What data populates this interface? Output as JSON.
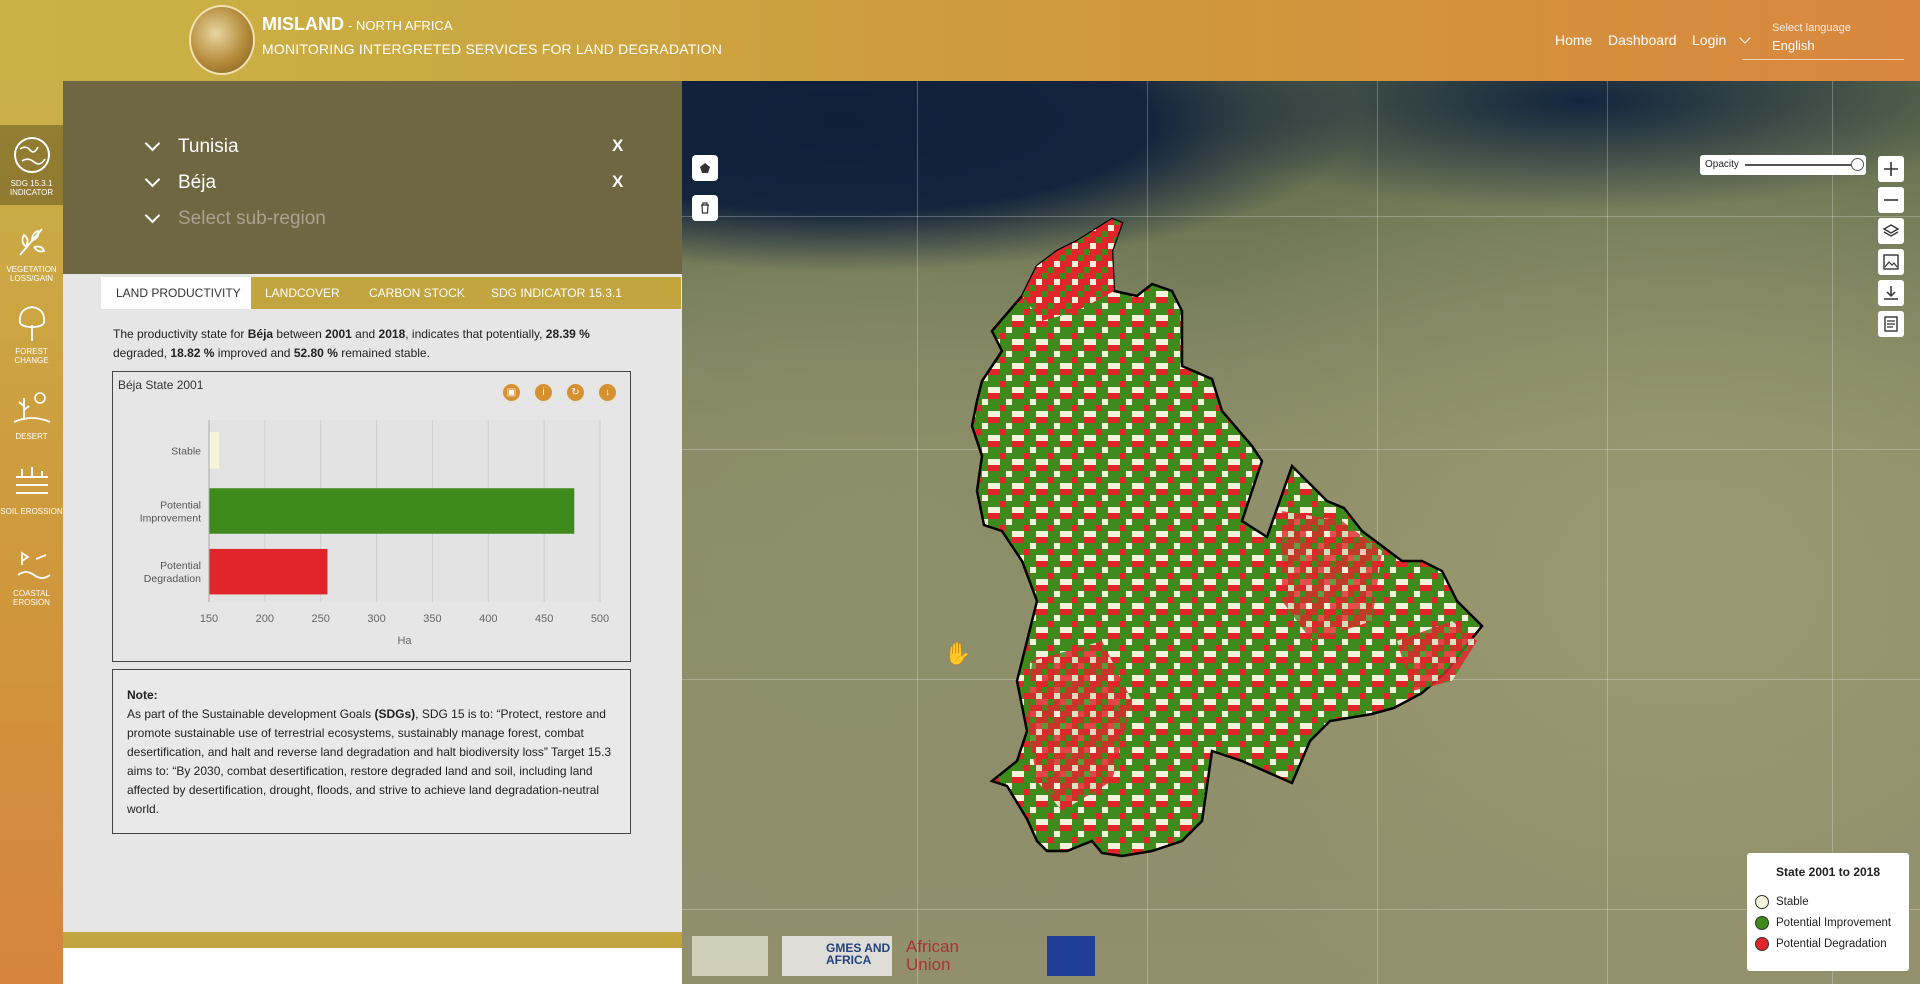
{
  "header": {
    "app_name": "MISLAND",
    "region": "- NORTH AFRICA",
    "subtitle": "MONITORING INTERGRETED SERVICES FOR LAND DEGRADATION",
    "nav": [
      "Home",
      "Dashboard",
      "Login"
    ],
    "language_label": "Select language",
    "language_value": "English"
  },
  "sidebar": {
    "items": [
      {
        "label": "SDG 15.3.1 INDICATOR",
        "icon": "globe-icon"
      },
      {
        "label": "VEGETATION LOSS/GAIN",
        "icon": "leaves-icon"
      },
      {
        "label": "FOREST CHANGE",
        "icon": "tree-icon"
      },
      {
        "label": "DESERT",
        "icon": "desert-icon"
      },
      {
        "label": "SOIL EROSSION",
        "icon": "soil-icon"
      },
      {
        "label": "COASTAL EROSION",
        "icon": "coast-icon"
      }
    ]
  },
  "region_selector": {
    "country": "Tunisia",
    "region": "Béja",
    "subregion_placeholder": "Select sub-region",
    "clear": "X"
  },
  "tabs": [
    "LAND PRODUCTIVITY",
    "LANDCOVER",
    "CARBON STOCK",
    "SDG INDICATOR 15.3.1"
  ],
  "description": {
    "p1": "The productivity state for ",
    "region": "Béja",
    "p2": " between ",
    "year1": "2001",
    "p3": " and ",
    "year2": "2018",
    "p4": ", indicates that potentially, ",
    "degraded": "28.39 %",
    "p5": " degraded, ",
    "improved": "18.82 %",
    "p6": " improved and ",
    "stable": "52.80 %",
    "p7": " remained stable."
  },
  "chart_data": {
    "type": "bar",
    "orientation": "horizontal",
    "title": "Béja State 2001",
    "categories": [
      "Stable",
      "Potential Improvement",
      "Potential Degradation"
    ],
    "category_lines": [
      [
        "Stable"
      ],
      [
        "Potential",
        "Improvement"
      ],
      [
        "Potential",
        "Degradation"
      ]
    ],
    "values": [
      159,
      477,
      256
    ],
    "colors": [
      "#f5f5dc",
      "#3f8a1c",
      "#e0262b"
    ],
    "xlabel": "Ha",
    "xlim": [
      150,
      500
    ],
    "xticks": [
      150,
      200,
      250,
      300,
      350,
      400,
      450,
      500
    ],
    "grid": true
  },
  "chart_tools": [
    "image-icon",
    "info-icon",
    "refresh-icon",
    "download-icon"
  ],
  "note": {
    "title": "Note:",
    "lead": "As part of the Sustainable development Goals ",
    "sdgs": "(SDGs)",
    "body": ", SDG 15 is to: “Protect, restore and promote sustainable use of terrestrial ecosystems, sustainably manage forest, combat desertification, and halt and reverse land degradation and halt biodiversity loss” Target 15.3 aims to: “By 2030, combat desertification, restore degraded land and soil, including land affected by desertification, drought, floods, and strive to achieve land degradation-neutral world."
  },
  "map": {
    "opacity_label": "Opacity",
    "opacity_value": 1,
    "legend": {
      "title": "State 2001 to 2018",
      "items": [
        {
          "label": "Stable",
          "color": "#f5f5dc"
        },
        {
          "label": "Potential Improvement",
          "color": "#3f8a1c"
        },
        {
          "label": "Potential Degradation",
          "color": "#e0262b"
        }
      ]
    },
    "partners": [
      "GMES AND AFRICA",
      "African Union"
    ]
  }
}
